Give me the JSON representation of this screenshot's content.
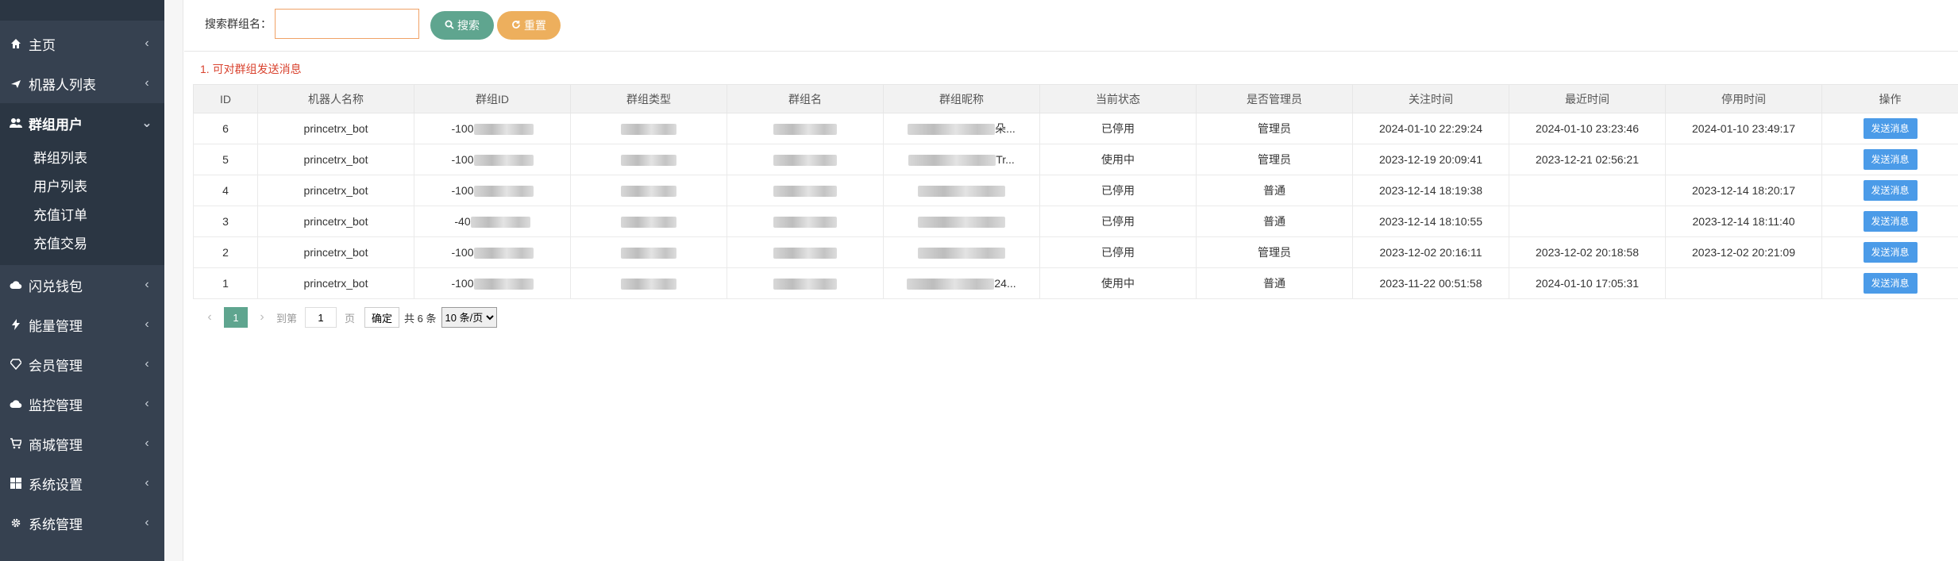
{
  "sidebar": {
    "items": [
      {
        "label": "主页",
        "icon": "home-icon"
      },
      {
        "label": "机器人列表",
        "icon": "plane-icon"
      },
      {
        "label": "群组用户",
        "icon": "users-icon"
      },
      {
        "label": "闪兑钱包",
        "icon": "cloud-icon"
      },
      {
        "label": "能量管理",
        "icon": "bolt-icon"
      },
      {
        "label": "会员管理",
        "icon": "diamond-icon"
      },
      {
        "label": "监控管理",
        "icon": "cloud-icon"
      },
      {
        "label": "商城管理",
        "icon": "cart-icon"
      },
      {
        "label": "系统设置",
        "icon": "windows-icon"
      },
      {
        "label": "系统管理",
        "icon": "gear-icon"
      }
    ],
    "submenu": [
      "群组列表",
      "用户列表",
      "充值订单",
      "充值交易"
    ],
    "arrow_closed": "‹",
    "arrow_open": "⌄"
  },
  "search": {
    "label": "搜索群组名：",
    "value": "",
    "search_button": "搜索",
    "reset_button": "重置"
  },
  "notice": "1. 可对群组发送消息",
  "table": {
    "columns": [
      "ID",
      "机器人名称",
      "群组ID",
      "群组类型",
      "群组名",
      "群组昵称",
      "当前状态",
      "是否管理员",
      "关注时间",
      "最近时间",
      "停用时间",
      "操作"
    ],
    "rows": [
      {
        "id": "6",
        "bot": "princetrx_bot",
        "group_id": "-100",
        "group_type": "",
        "group_name": "",
        "nick": "朵...",
        "status": "已停用",
        "admin": "管理员",
        "follow": "2024-01-10 22:29:24",
        "recent": "2024-01-10 23:23:46",
        "stopped": "2024-01-10 23:49:17",
        "action": "发送消息"
      },
      {
        "id": "5",
        "bot": "princetrx_bot",
        "group_id": "-100",
        "group_type": "",
        "group_name": "",
        "nick": "Tr...",
        "status": "使用中",
        "admin": "管理员",
        "follow": "2023-12-19 20:09:41",
        "recent": "2023-12-21 02:56:21",
        "stopped": "",
        "action": "发送消息"
      },
      {
        "id": "4",
        "bot": "princetrx_bot",
        "group_id": "-100",
        "group_type": "",
        "group_name": "",
        "nick": "",
        "status": "已停用",
        "admin": "普通",
        "follow": "2023-12-14 18:19:38",
        "recent": "",
        "stopped": "2023-12-14 18:20:17",
        "action": "发送消息"
      },
      {
        "id": "3",
        "bot": "princetrx_bot",
        "group_id": "-40",
        "group_type": "",
        "group_name": "",
        "nick": "",
        "status": "已停用",
        "admin": "普通",
        "follow": "2023-12-14 18:10:55",
        "recent": "",
        "stopped": "2023-12-14 18:11:40",
        "action": "发送消息"
      },
      {
        "id": "2",
        "bot": "princetrx_bot",
        "group_id": "-100",
        "group_type": "",
        "group_name": "",
        "nick": "",
        "status": "已停用",
        "admin": "管理员",
        "follow": "2023-12-02 20:16:11",
        "recent": "2023-12-02 20:18:58",
        "stopped": "2023-12-02 20:21:09",
        "action": "发送消息"
      },
      {
        "id": "1",
        "bot": "princetrx_bot",
        "group_id": "-100",
        "group_type": "",
        "group_name": "",
        "nick": "24...",
        "status": "使用中",
        "admin": "普通",
        "follow": "2023-11-22 00:51:58",
        "recent": "2024-01-10 17:05:31",
        "stopped": "",
        "action": "发送消息"
      }
    ]
  },
  "pager": {
    "current": "1",
    "goto_label": "到第",
    "goto_value": "1",
    "page_unit": "页",
    "confirm": "确定",
    "total": "共 6 条",
    "page_size": "10 条/页"
  }
}
